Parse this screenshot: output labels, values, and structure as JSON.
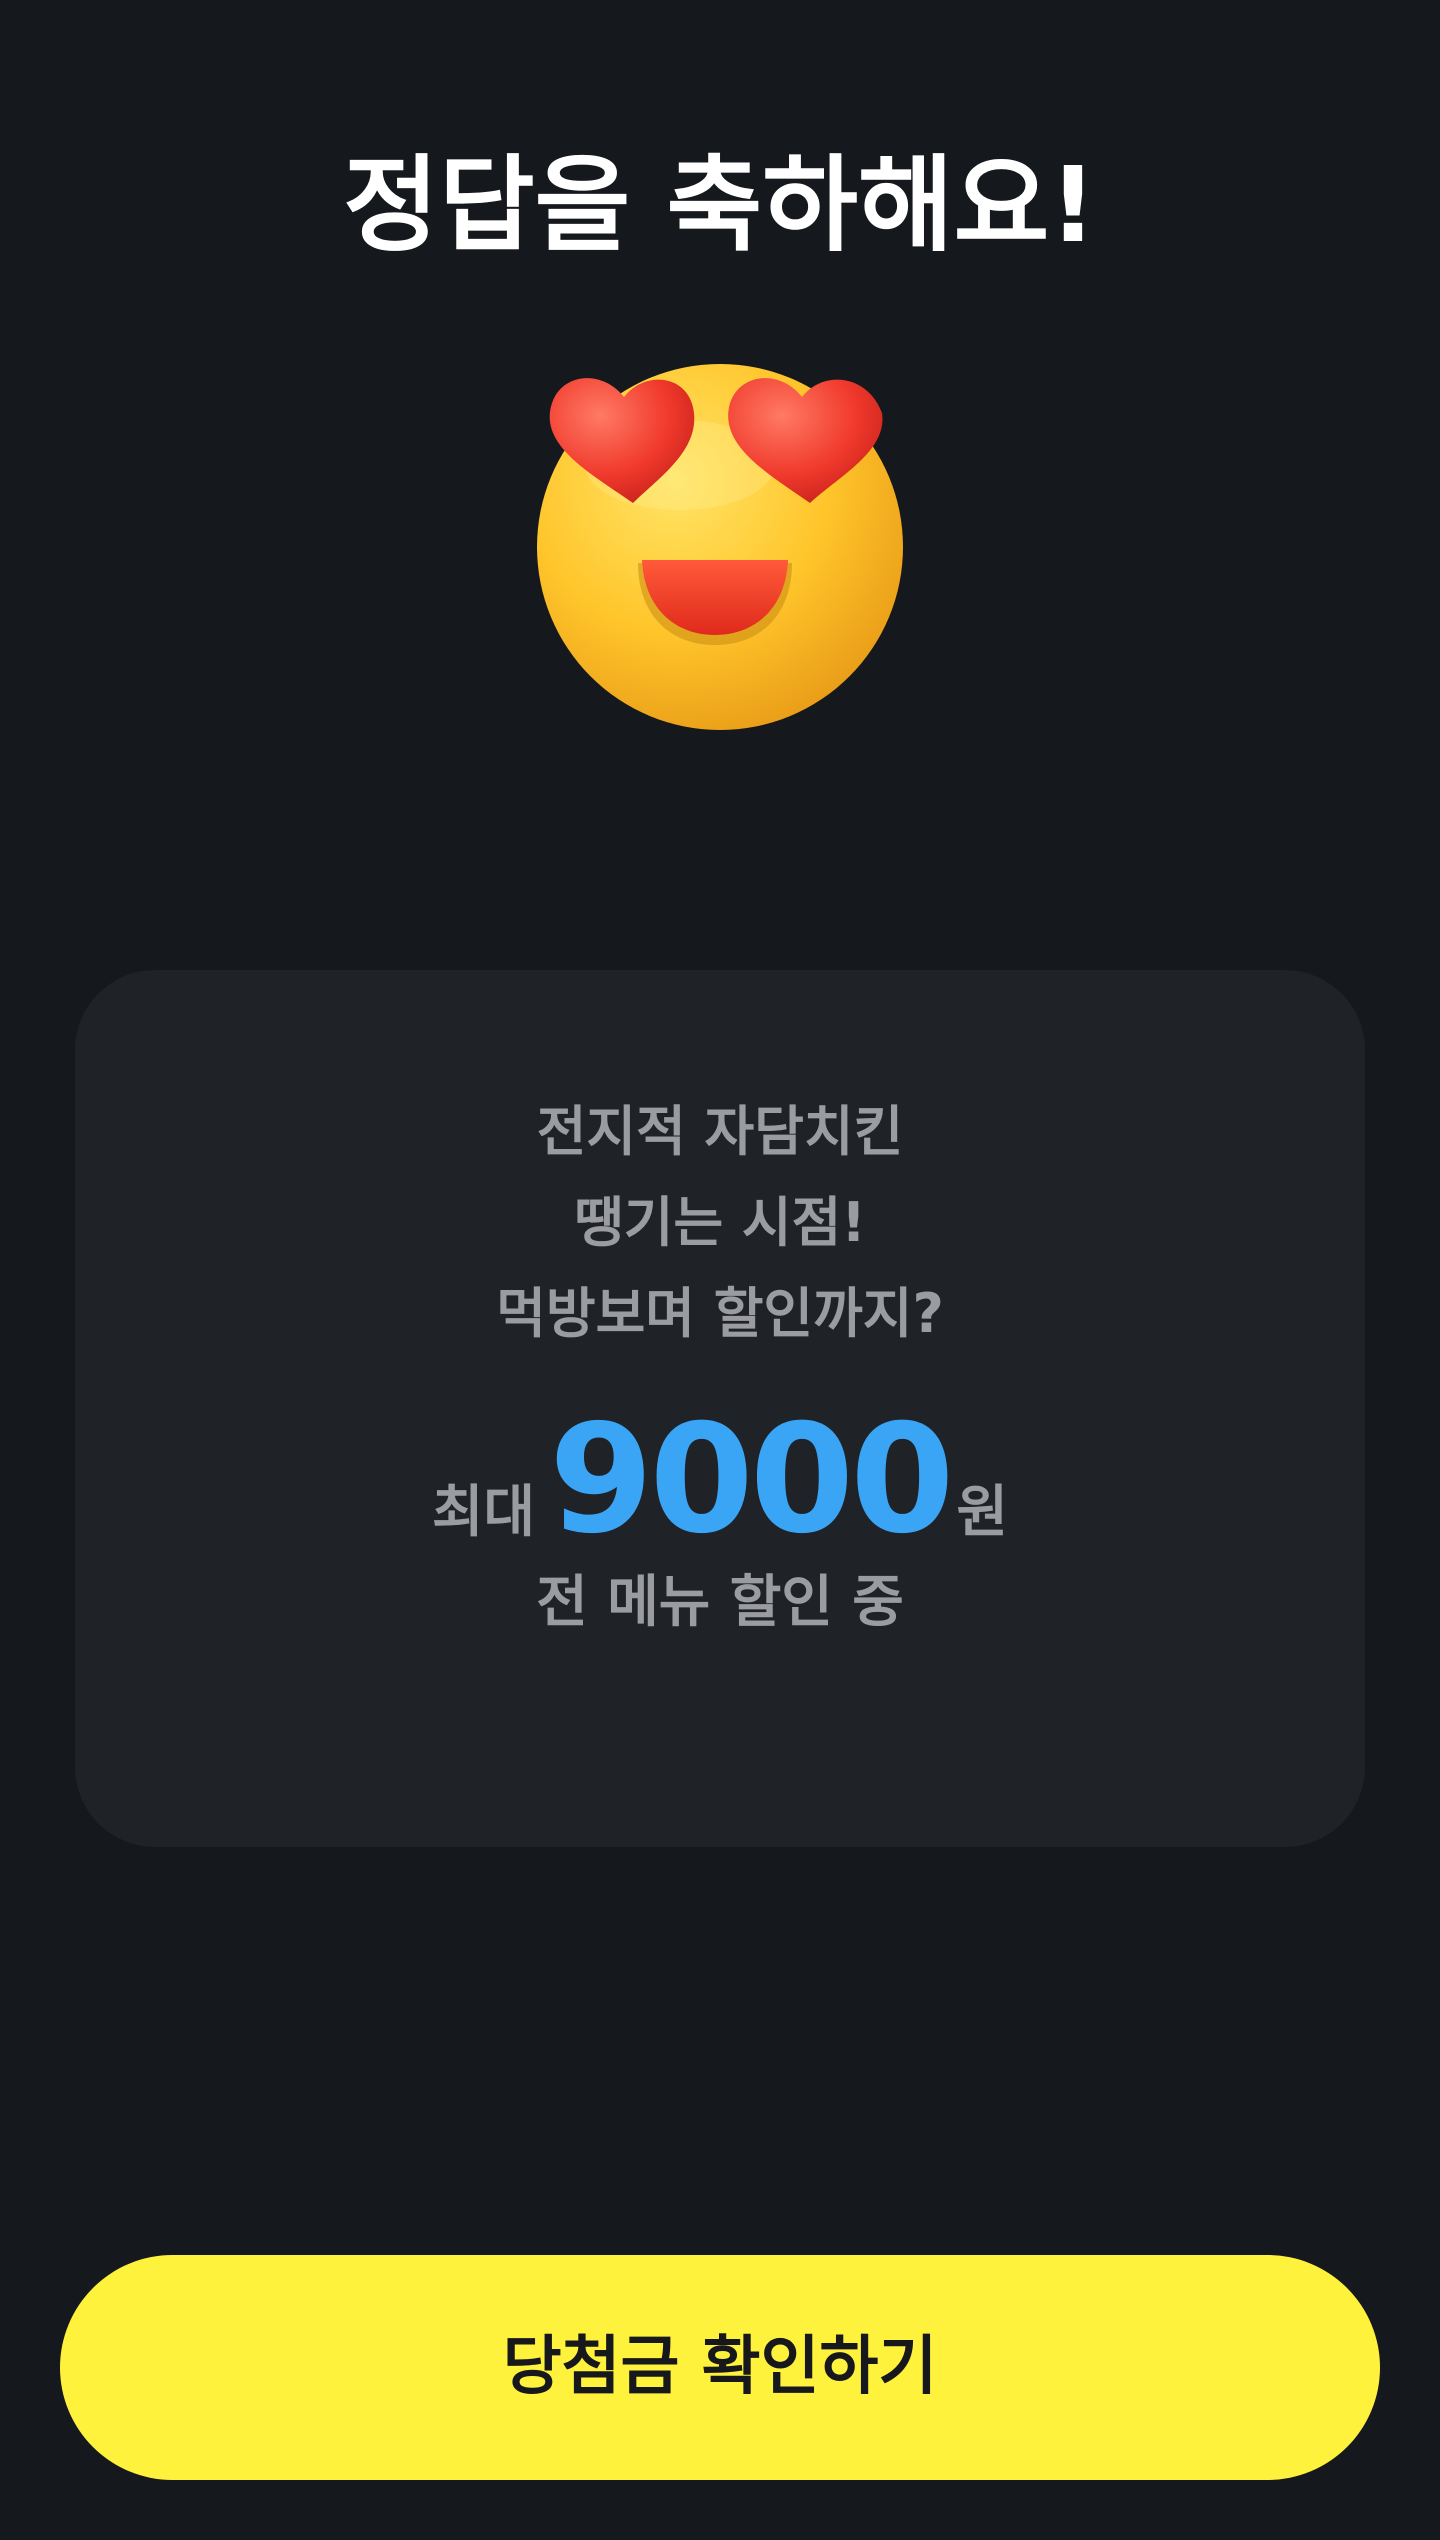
{
  "header": {
    "title": "정답을 축하해요!"
  },
  "illustration": {
    "icon": "heart-eyes-emoji-icon"
  },
  "promo_card": {
    "line1": "전지적 자담치킨",
    "line2": "땡기는 시점!",
    "line3": "먹방보며 할인까지?",
    "discount_prefix": "최대",
    "discount_amount": "9000",
    "discount_unit": "원",
    "line4": "전 메뉴 할인 중"
  },
  "cta": {
    "label": "당첨금 확인하기"
  },
  "colors": {
    "background": "#15181c",
    "card": "#1f2226",
    "accent_blue": "#3aa4f5",
    "button_yellow": "#fff23d",
    "muted_text": "#9a9ca0"
  }
}
